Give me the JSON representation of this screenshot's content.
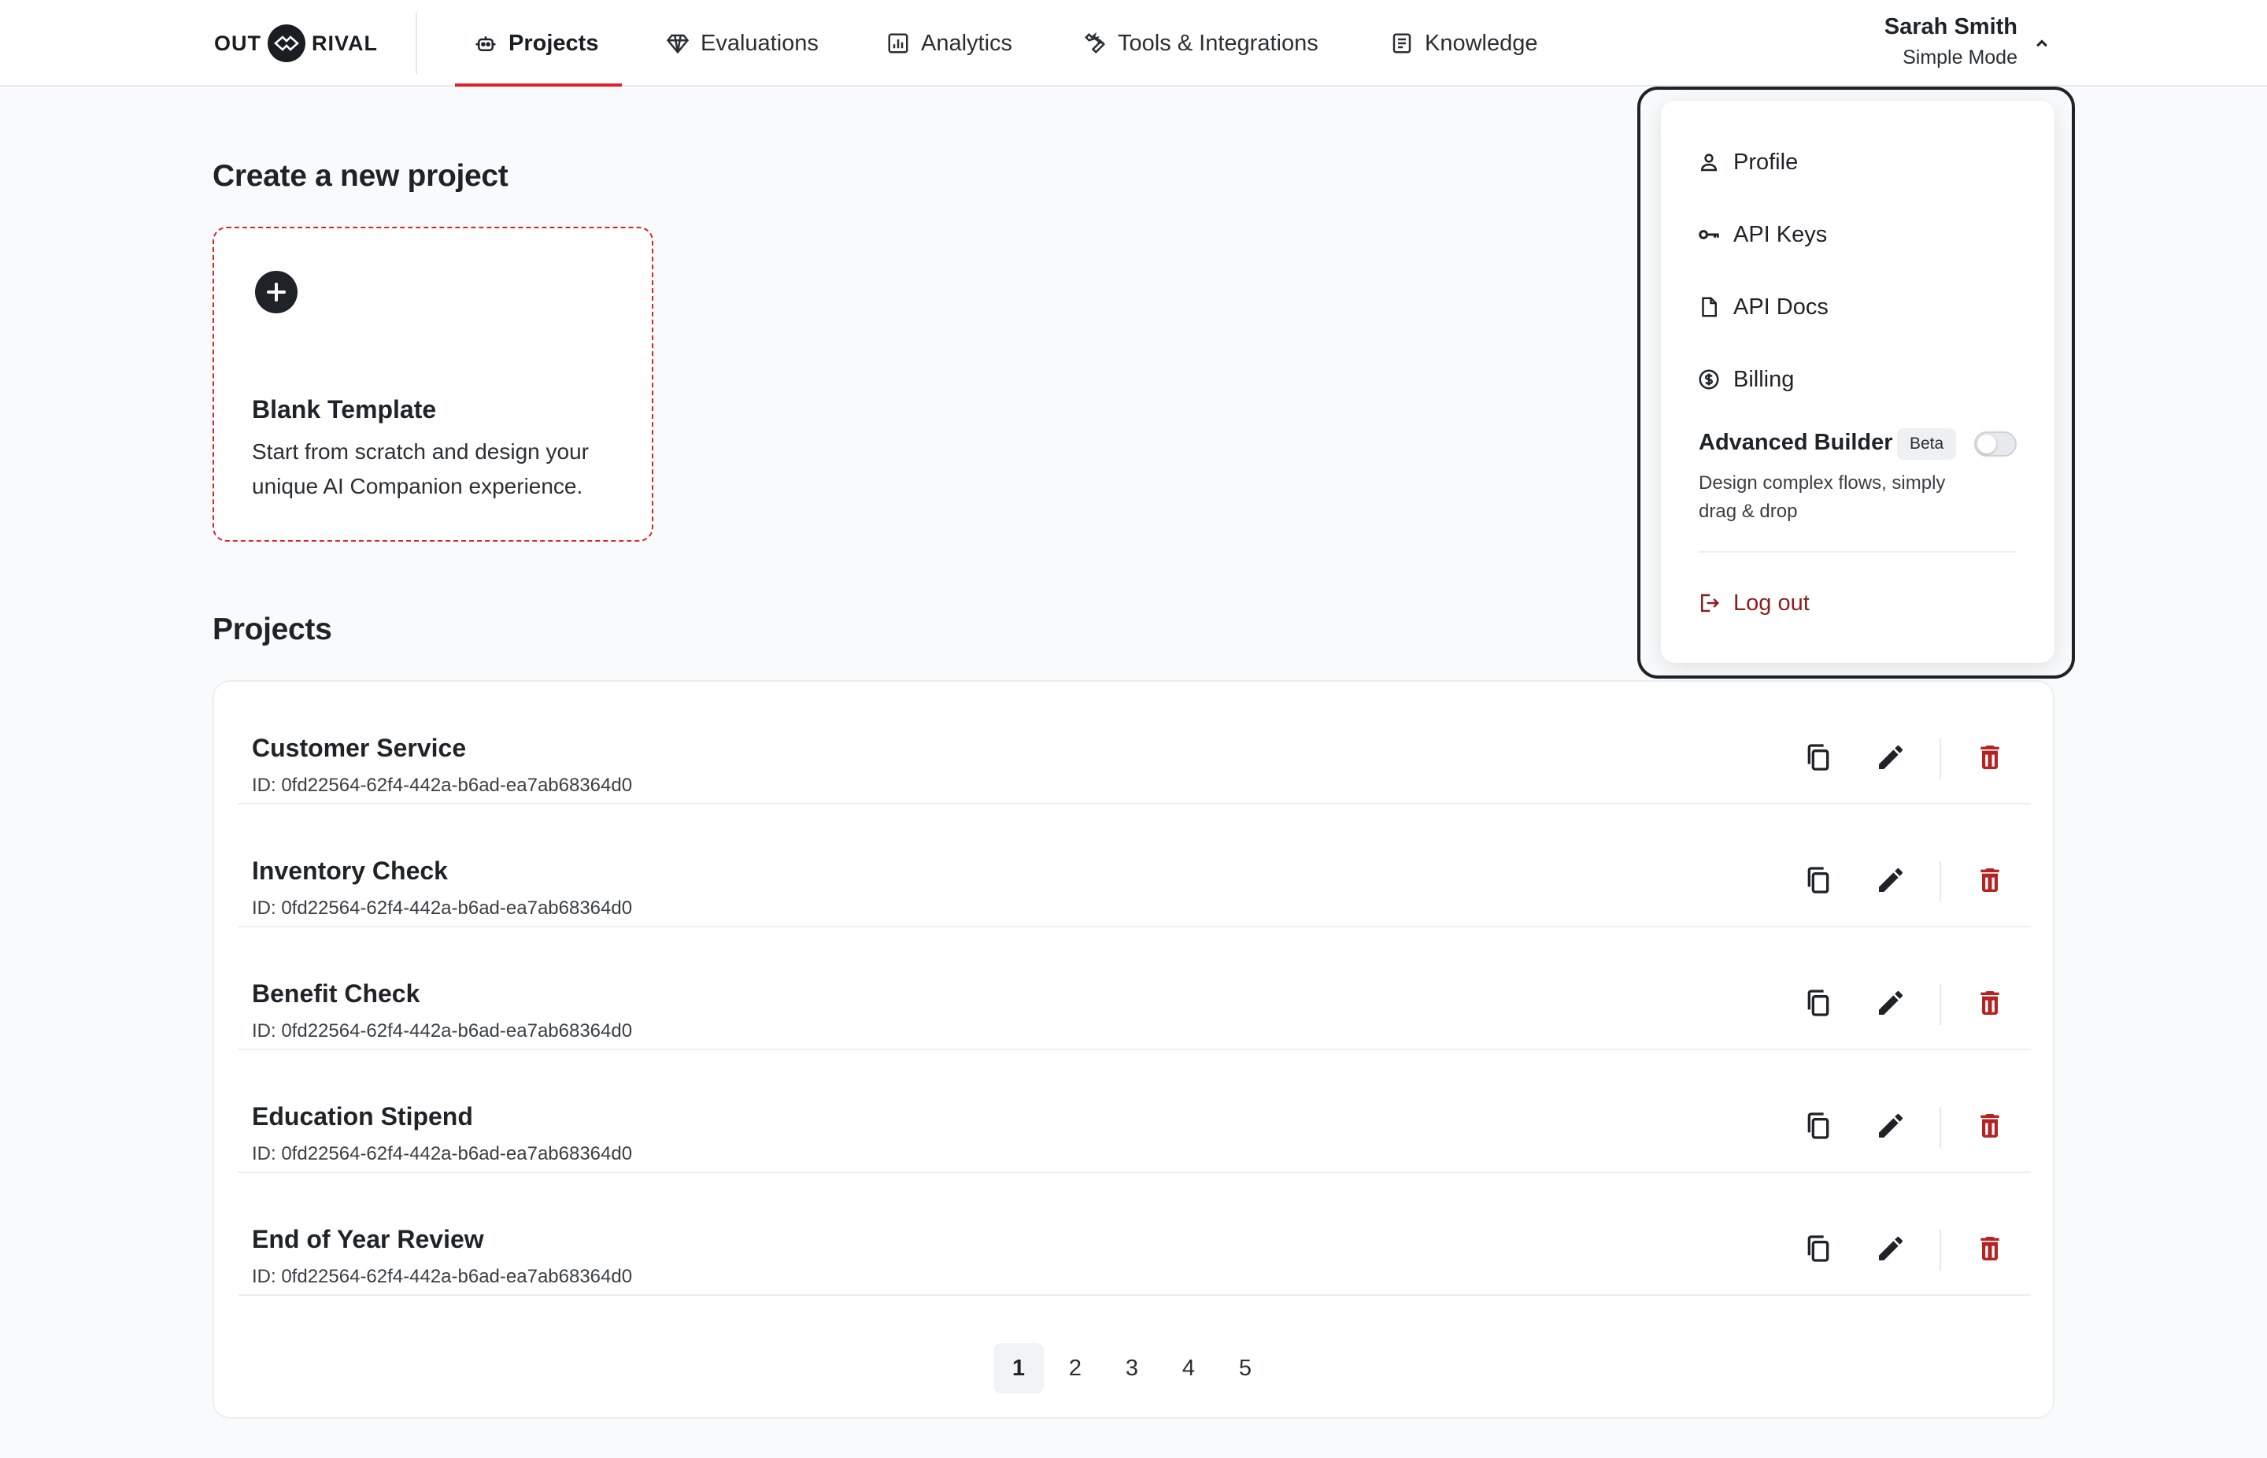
{
  "header": {
    "logo_text_left": "OUT",
    "logo_text_right": "RIVAL",
    "nav": [
      {
        "label": "Projects",
        "icon": "robot-icon",
        "active": true
      },
      {
        "label": "Evaluations",
        "icon": "diamond-icon",
        "active": false
      },
      {
        "label": "Analytics",
        "icon": "bar-chart-icon",
        "active": false
      },
      {
        "label": "Tools & Integrations",
        "icon": "wrench-icon",
        "active": false
      },
      {
        "label": "Knowledge",
        "icon": "document-list-icon",
        "active": false
      }
    ],
    "user": {
      "name": "Sarah Smith",
      "mode": "Simple Mode"
    }
  },
  "create": {
    "heading": "Create a new project",
    "blank_template": {
      "title": "Blank Template",
      "description": "Start from scratch and design your unique AI Companion experience."
    }
  },
  "projects": {
    "heading": "Projects",
    "rows": [
      {
        "title": "Customer Service",
        "id": "ID: 0fd22564-62f4-442a-b6ad-ea7ab68364d0"
      },
      {
        "title": "Inventory Check",
        "id": "ID: 0fd22564-62f4-442a-b6ad-ea7ab68364d0"
      },
      {
        "title": "Benefit Check",
        "id": "ID: 0fd22564-62f4-442a-b6ad-ea7ab68364d0"
      },
      {
        "title": "Education Stipend",
        "id": "ID: 0fd22564-62f4-442a-b6ad-ea7ab68364d0"
      },
      {
        "title": "End of Year Review",
        "id": "ID: 0fd22564-62f4-442a-b6ad-ea7ab68364d0"
      }
    ],
    "pagination": {
      "pages": [
        "1",
        "2",
        "3",
        "4",
        "5"
      ],
      "current": "1"
    }
  },
  "user_menu": {
    "items": [
      {
        "label": "Profile",
        "icon": "user-icon"
      },
      {
        "label": "API Keys",
        "icon": "key-icon"
      },
      {
        "label": "API Docs",
        "icon": "file-icon"
      },
      {
        "label": "Billing",
        "icon": "dollar-circle-icon"
      }
    ],
    "advanced_builder": {
      "title": "Advanced Builder",
      "badge": "Beta",
      "enabled": false,
      "description": "Design complex flows, simply drag & drop"
    },
    "logout": {
      "label": "Log out",
      "icon": "logout-icon"
    }
  },
  "colors": {
    "accent": "#e0202b",
    "danger": "#8a1f1f",
    "text": "#1f2328",
    "background": "#f9fafb"
  }
}
